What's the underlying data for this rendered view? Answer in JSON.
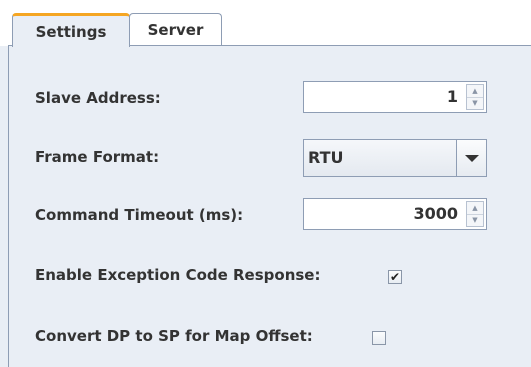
{
  "tabs": [
    {
      "label": "Settings",
      "selected": true
    },
    {
      "label": "Server",
      "selected": false
    }
  ],
  "form": {
    "slave_address": {
      "label": "Slave Address:",
      "value": "1"
    },
    "frame_format": {
      "label": "Frame Format:",
      "value": "RTU"
    },
    "command_timeout": {
      "label": "Command Timeout (ms):",
      "value": "3000"
    },
    "exception_response": {
      "label": "Enable Exception Code Response:",
      "checked": true,
      "mark": "✔"
    },
    "convert_dp": {
      "label": "Convert DP to SP for Map Offset:",
      "checked": false
    }
  },
  "colors": {
    "selected_tab_accent": "#f5a623",
    "panel_bg": "#e9eef5",
    "border": "#8e9db4"
  }
}
